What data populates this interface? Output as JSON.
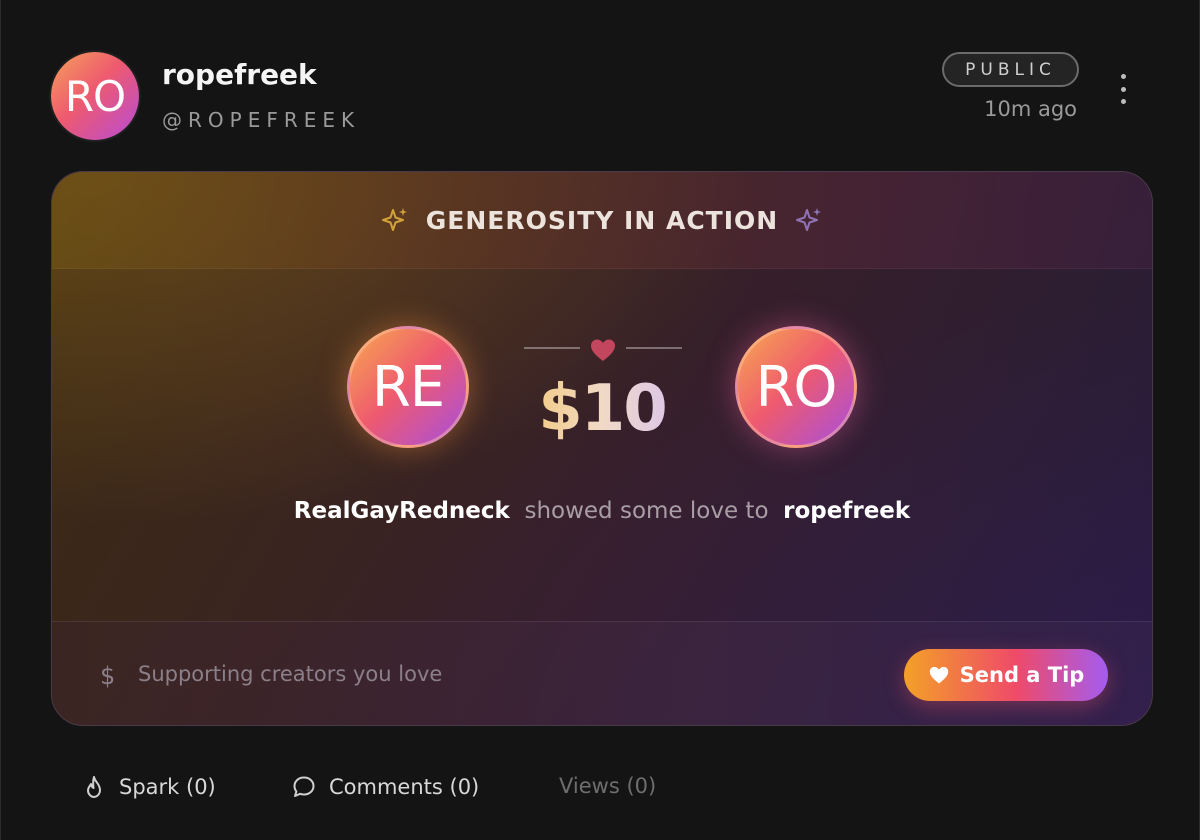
{
  "post": {
    "avatar_initials": "RO",
    "username": "ropefreek",
    "handle": "@ROPEFREEK",
    "visibility": "PUBLIC",
    "time_ago": "10m ago"
  },
  "card": {
    "banner_title": "GENEROSITY IN ACTION",
    "sender_initials": "RE",
    "receiver_initials": "RO",
    "amount": "$10",
    "sender_name": "RealGayRedneck",
    "message_middle": "showed some love to",
    "receiver_name": "ropefreek",
    "dollar_icon": "$",
    "footer_text": "Supporting creators you love",
    "tip_button_label": "Send a Tip"
  },
  "actions": {
    "spark": "Spark (0)",
    "comments": "Comments (0)",
    "views": "Views (0)"
  },
  "colors": {
    "accent_orange": "#f3a127",
    "accent_pink": "#ef4a68",
    "accent_purple": "#a45cf0",
    "background": "#141414"
  },
  "icons": [
    "more-vertical-icon",
    "sparkle-icon",
    "heart-icon",
    "dollar-icon",
    "flame-icon",
    "comment-icon"
  ]
}
